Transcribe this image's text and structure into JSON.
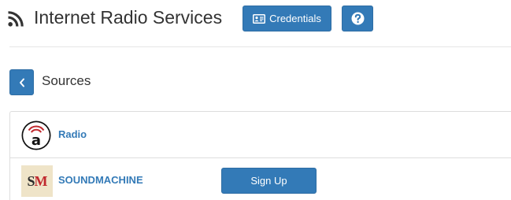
{
  "header": {
    "title": "Internet Radio Services",
    "icon": "rss-icon",
    "credentials_label": "Credentials",
    "credentials_icon": "id-card-icon",
    "help_icon": "question-circle-icon"
  },
  "section": {
    "title": "Sources",
    "back_icon": "chevron-left-icon"
  },
  "sources": [
    {
      "name": "Radio",
      "logo": "radio-logo"
    },
    {
      "name": "SOUNDMACHINE",
      "logo": "soundmachine-logo",
      "logo_text_s": "S",
      "logo_text_m": "M",
      "action_label": "Sign Up"
    }
  ],
  "colors": {
    "primary": "#337ab7",
    "primary_border": "#2e6da4",
    "text": "#333333",
    "border": "#dddddd",
    "logo_accent": "#c0282d"
  }
}
